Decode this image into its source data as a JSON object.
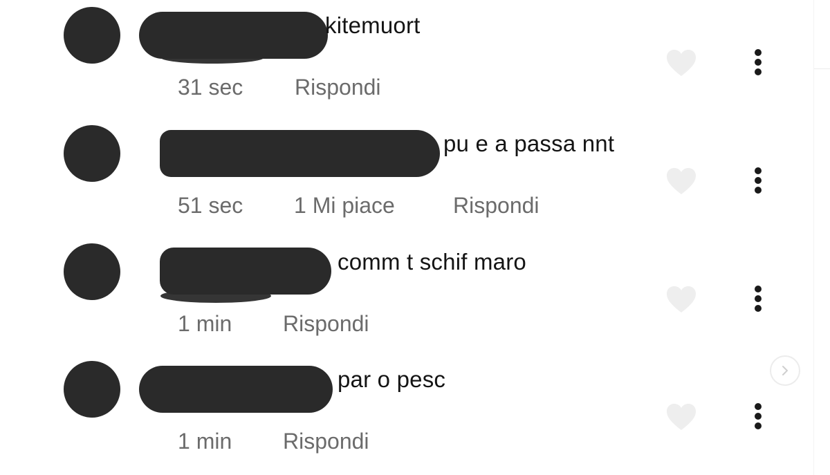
{
  "comments": [
    {
      "text": "kitemuort",
      "time": "31 sec",
      "likes": "",
      "reply": "Rispondi"
    },
    {
      "text": "pu e a passa nnt",
      "time": "51 sec",
      "likes": "1 Mi piace",
      "reply": "Rispondi"
    },
    {
      "text": "comm t schif maro",
      "time": "1 min",
      "likes": "",
      "reply": "Rispondi"
    },
    {
      "text": "par o pesc",
      "time": "1 min",
      "likes": "",
      "reply": "Rispondi"
    }
  ],
  "icons": {
    "like": "heart-icon",
    "more": "more-options-icon",
    "next": "chevron-right-icon"
  },
  "colors": {
    "redaction": "#2a2a2a",
    "text": "#141414",
    "meta": "#6b6b6b",
    "like_icon": "#eeeeee"
  }
}
